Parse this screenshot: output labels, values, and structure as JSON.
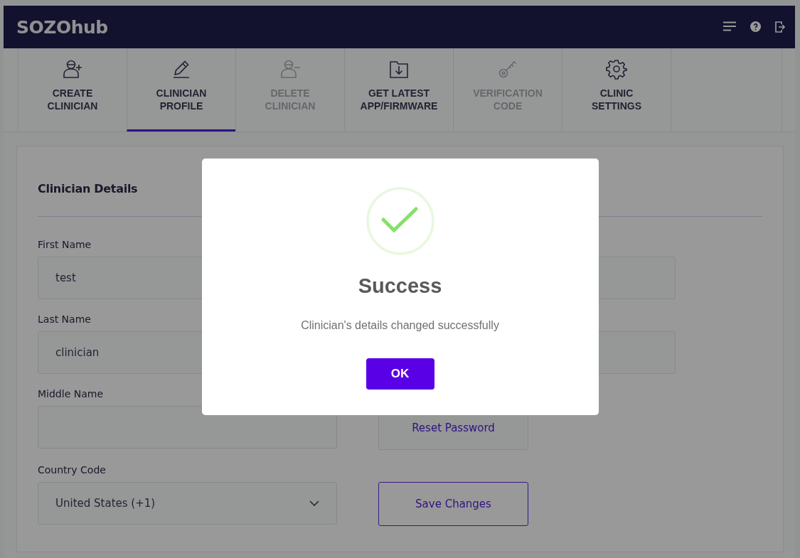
{
  "app": {
    "title": "SOZOhub"
  },
  "tabs": [
    {
      "label": "CREATE CLINICIAN",
      "kind": "person-plus",
      "selected": false,
      "disabled": false
    },
    {
      "label": "CLINICIAN PROFILE",
      "kind": "pencil",
      "selected": true,
      "disabled": false
    },
    {
      "label": "DELETE CLINICIAN",
      "kind": "person-minus",
      "selected": false,
      "disabled": true
    },
    {
      "label": "GET LATEST APP/FIRMWARE",
      "kind": "folder-download",
      "selected": false,
      "disabled": false
    },
    {
      "label": "VERIFICATION CODE",
      "kind": "key",
      "selected": false,
      "disabled": true
    },
    {
      "label": "CLINIC SETTINGS",
      "kind": "gear",
      "selected": false,
      "disabled": false
    }
  ],
  "form": {
    "title": "Clinician Details",
    "fields": [
      {
        "label": "First Name",
        "value": "test",
        "kind": "text"
      },
      {
        "label": "Last Name",
        "value": "clinician",
        "kind": "text"
      },
      {
        "label": "Middle Name",
        "kind": "text"
      },
      {
        "label": "Country Code",
        "value": "United States (+1)",
        "kind": "select"
      }
    ],
    "buttons": [
      {
        "label": "Reset Password",
        "kind": "plain"
      },
      {
        "label": "Save Changes",
        "kind": "outlined"
      }
    ]
  },
  "dialog": {
    "title": "Success",
    "message": "Clinician's details changed successfully",
    "button": "OK"
  }
}
